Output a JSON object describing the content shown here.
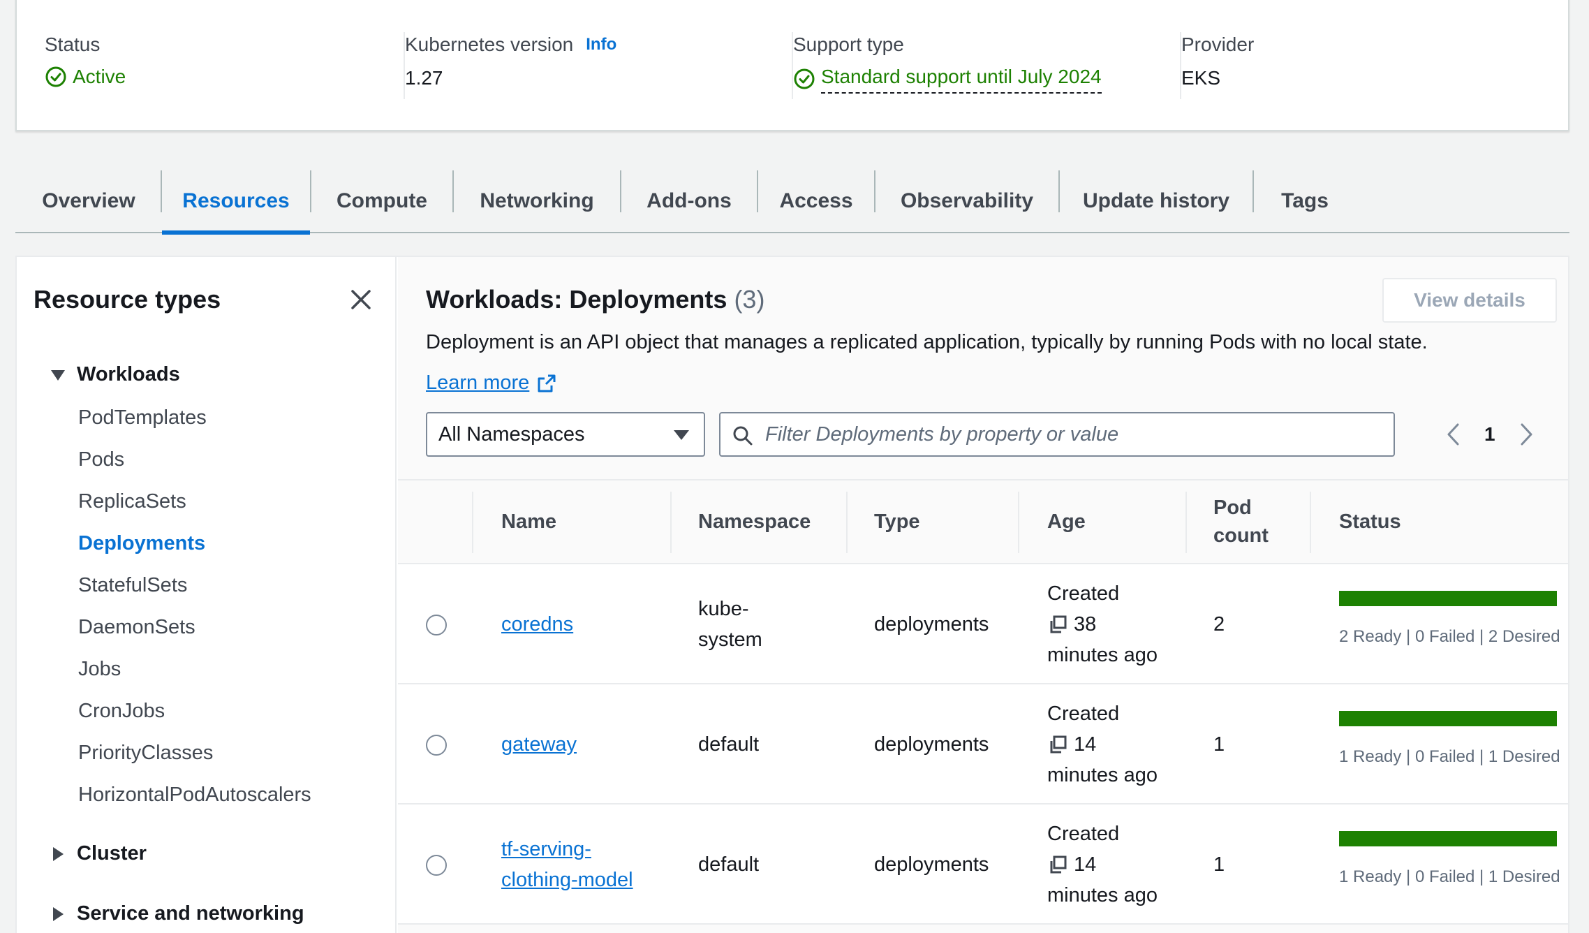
{
  "summary": {
    "status_label": "Status",
    "status_value": "Active",
    "k8s_label": "Kubernetes version",
    "k8s_info": "Info",
    "k8s_value": "1.27",
    "support_label": "Support type",
    "support_value": "Standard support until July 2024",
    "provider_label": "Provider",
    "provider_value": "EKS"
  },
  "tabs": [
    "Overview",
    "Resources",
    "Compute",
    "Networking",
    "Add-ons",
    "Access",
    "Observability",
    "Update history",
    "Tags"
  ],
  "active_tab": "Resources",
  "sidebar": {
    "title": "Resource types",
    "groups": {
      "workloads": "Workloads",
      "cluster": "Cluster",
      "service_networking": "Service and networking"
    },
    "items": [
      "PodTemplates",
      "Pods",
      "ReplicaSets",
      "Deployments",
      "StatefulSets",
      "DaemonSets",
      "Jobs",
      "CronJobs",
      "PriorityClasses",
      "HorizontalPodAutoscalers"
    ],
    "active_item": "Deployments"
  },
  "content": {
    "title": "Workloads: Deployments",
    "count": "(3)",
    "view_details": "View details",
    "description": "Deployment is an API object that manages a replicated application, typically by running Pods with no local state.",
    "learn_more": "Learn more",
    "namespace_select": "All Namespaces",
    "filter_placeholder": "Filter Deployments by property or value",
    "page": "1"
  },
  "table": {
    "headers": {
      "name": "Name",
      "namespace": "Namespace",
      "type": "Type",
      "age": "Age",
      "pod_count_1": "Pod",
      "pod_count_2": "count",
      "status": "Status"
    },
    "rows": [
      {
        "name_1": "coredns",
        "name_2": "",
        "namespace_1": "kube-",
        "namespace_2": "system",
        "type": "deployments",
        "age_1": "Created",
        "age_2": "38",
        "age_3": "minutes ago",
        "pod_count": "2",
        "ready_fraction": 1.0,
        "status_text": "2 Ready | 0 Failed | 2 Desired"
      },
      {
        "name_1": "gateway",
        "name_2": "",
        "namespace_1": "default",
        "namespace_2": "",
        "type": "deployments",
        "age_1": "Created",
        "age_2": "14",
        "age_3": "minutes ago",
        "pod_count": "1",
        "ready_fraction": 1.0,
        "status_text": "1 Ready | 0 Failed | 1 Desired"
      },
      {
        "name_1": "tf-serving-",
        "name_2": "clothing-model",
        "namespace_1": "default",
        "namespace_2": "",
        "type": "deployments",
        "age_1": "Created",
        "age_2": "14",
        "age_3": "minutes ago",
        "pod_count": "1",
        "ready_fraction": 1.0,
        "status_text": "1 Ready | 0 Failed | 1 Desired"
      }
    ]
  },
  "colors": {
    "accent": "#0972d3",
    "success": "#1d8102",
    "text": "#16191f",
    "muted": "#5f6b7a"
  },
  "icons": {
    "status": "check-circle-icon",
    "close": "close-icon",
    "external": "external-link-icon",
    "search": "search-icon",
    "copy": "copy-icon",
    "caret": "caret-down-icon"
  }
}
